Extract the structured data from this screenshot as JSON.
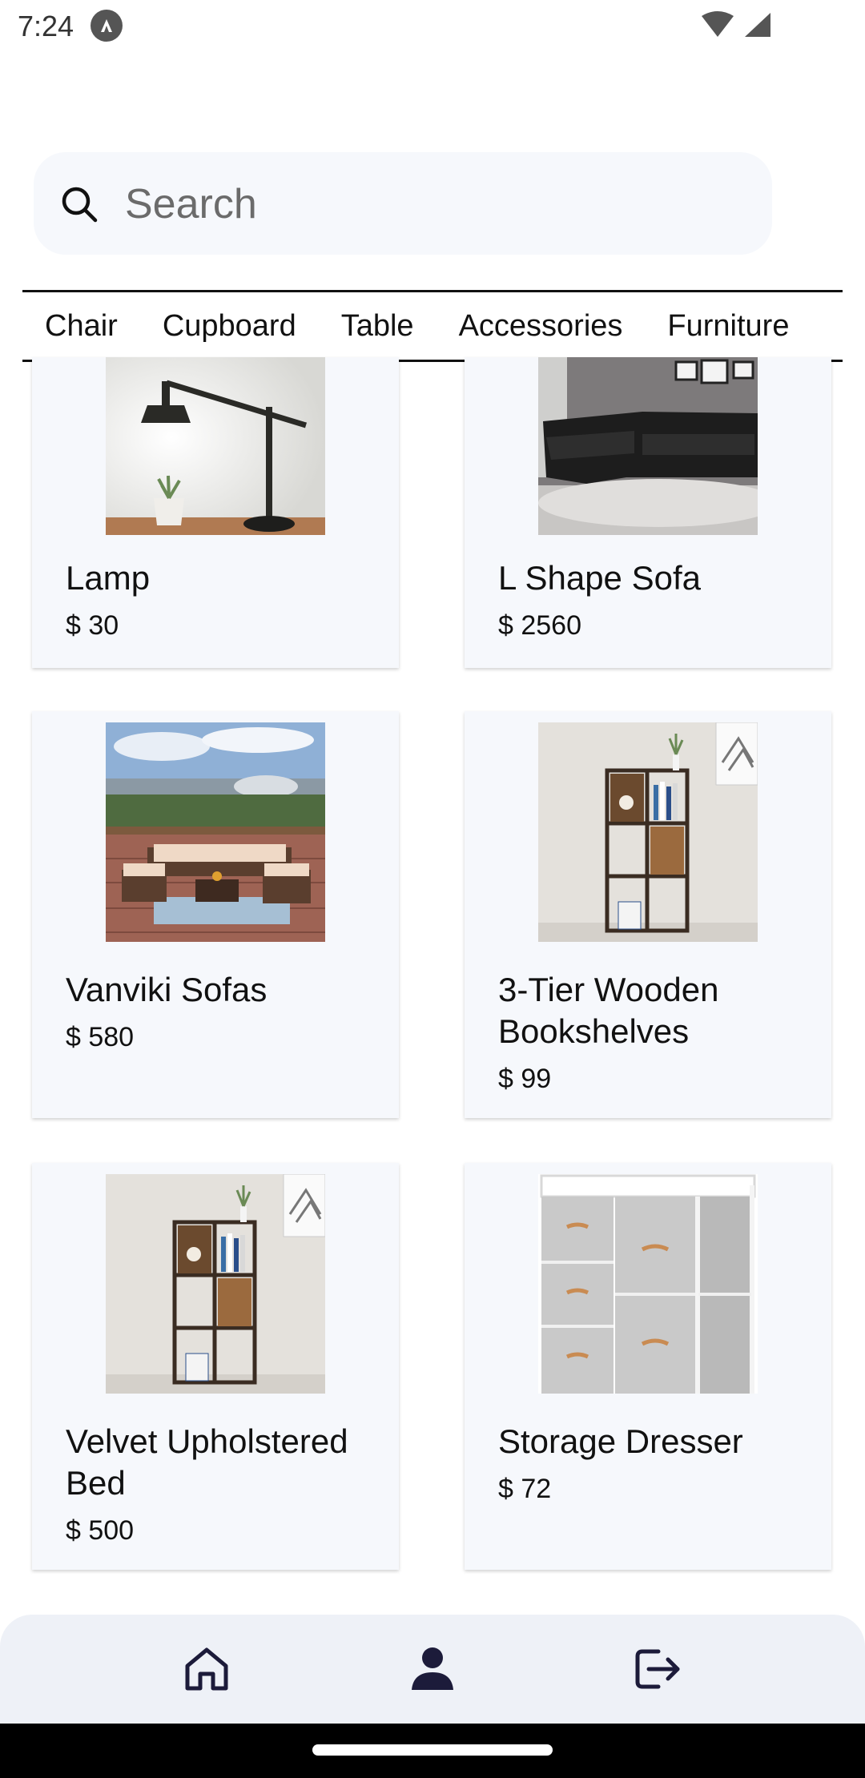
{
  "status_bar": {
    "time": "7:24",
    "icons": [
      "a-icon",
      "wifi-icon",
      "signal-icon"
    ]
  },
  "search": {
    "placeholder": "Search",
    "value": ""
  },
  "tabs": [
    "Chair",
    "Cupboard",
    "Table",
    "Accessories",
    "Furniture"
  ],
  "products": [
    {
      "name": "Lamp",
      "price": "$ 30"
    },
    {
      "name": "L Shape Sofa",
      "price": "$ 2560"
    },
    {
      "name": "Vanviki Sofas",
      "price": "$ 580"
    },
    {
      "name": "3-Tier Wooden Bookshelves",
      "price": "$ 99"
    },
    {
      "name": "Velvet Upholstered Bed",
      "price": "$ 500"
    },
    {
      "name": "Storage Dresser",
      "price": "$ 72"
    }
  ],
  "bottom_nav": {
    "items": [
      "home-icon",
      "profile-icon",
      "logout-icon"
    ],
    "active": "profile-icon"
  },
  "colors": {
    "card_bg": "#f6f8fc",
    "nav_bg": "#eef1f7",
    "icon": "#1c1b3a"
  }
}
